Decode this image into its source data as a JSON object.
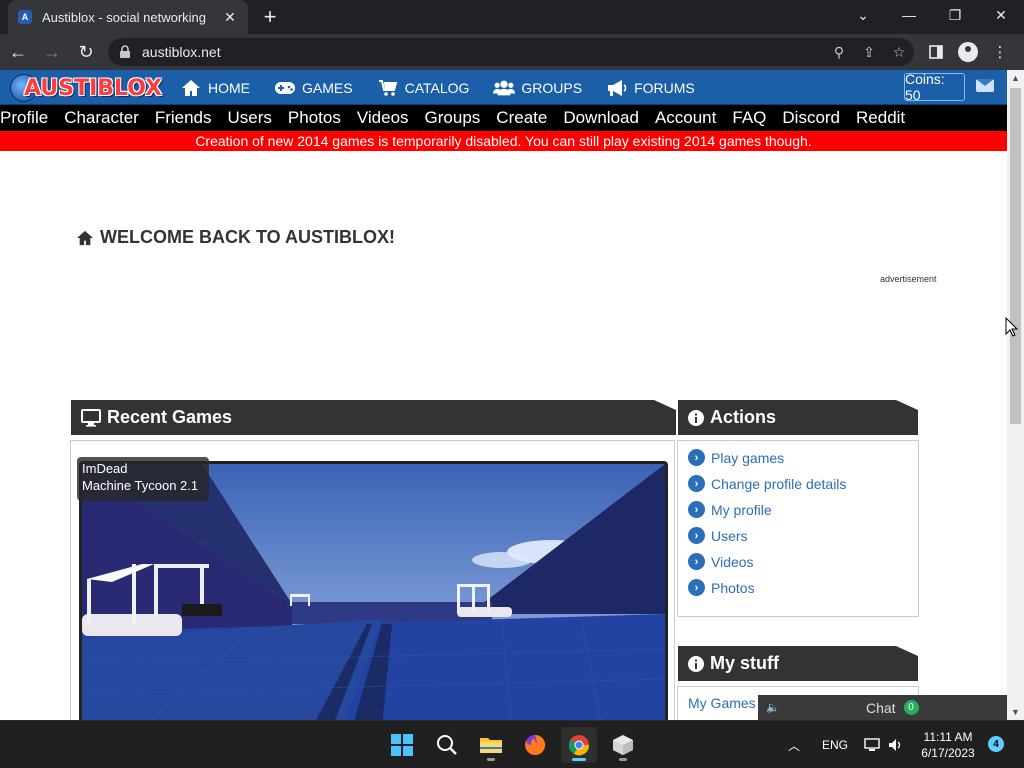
{
  "browser": {
    "tab_title": "Austiblox - social networking",
    "url": "austiblox.net"
  },
  "site": {
    "logo_text": "AUSTIBLOX",
    "main_nav": [
      {
        "label": "HOME",
        "icon": "home-icon"
      },
      {
        "label": "GAMES",
        "icon": "gamepad-icon"
      },
      {
        "label": "CATALOG",
        "icon": "cart-icon"
      },
      {
        "label": "GROUPS",
        "icon": "users-icon"
      },
      {
        "label": "FORUMS",
        "icon": "bullhorn-icon"
      }
    ],
    "coins_label": "Coins: 50",
    "sub_nav": [
      "Profile",
      "Character",
      "Friends",
      "Users",
      "Photos",
      "Videos",
      "Groups",
      "Create",
      "Download",
      "Account",
      "FAQ",
      "Discord",
      "Reddit"
    ],
    "alert_text": "Creation of new 2014 games is temporarily disabled. You can still play existing 2014 games though.",
    "welcome_title": "WELCOME BACK TO AUSTIBLOX!",
    "ad_label": "advertisement"
  },
  "recent_games": {
    "title": "Recent Games",
    "game_author": "ImDead",
    "game_name": "Machine Tycoon 2.1"
  },
  "actions": {
    "title": "Actions",
    "items": [
      "Play games",
      "Change profile details",
      "My profile",
      "Users",
      "Videos",
      "Photos"
    ]
  },
  "my_stuff": {
    "title": "My stuff",
    "items": [
      "My Games"
    ]
  },
  "chat": {
    "label": "Chat",
    "count": "0"
  },
  "taskbar": {
    "language": "ENG",
    "time": "11:11 AM",
    "date": "6/17/2023",
    "notifications": "4"
  },
  "colors": {
    "nav_blue": "#1a5fa8",
    "alert_red": "#ff0000",
    "link_blue": "#2a6fb8",
    "panel_dark": "#333333"
  }
}
